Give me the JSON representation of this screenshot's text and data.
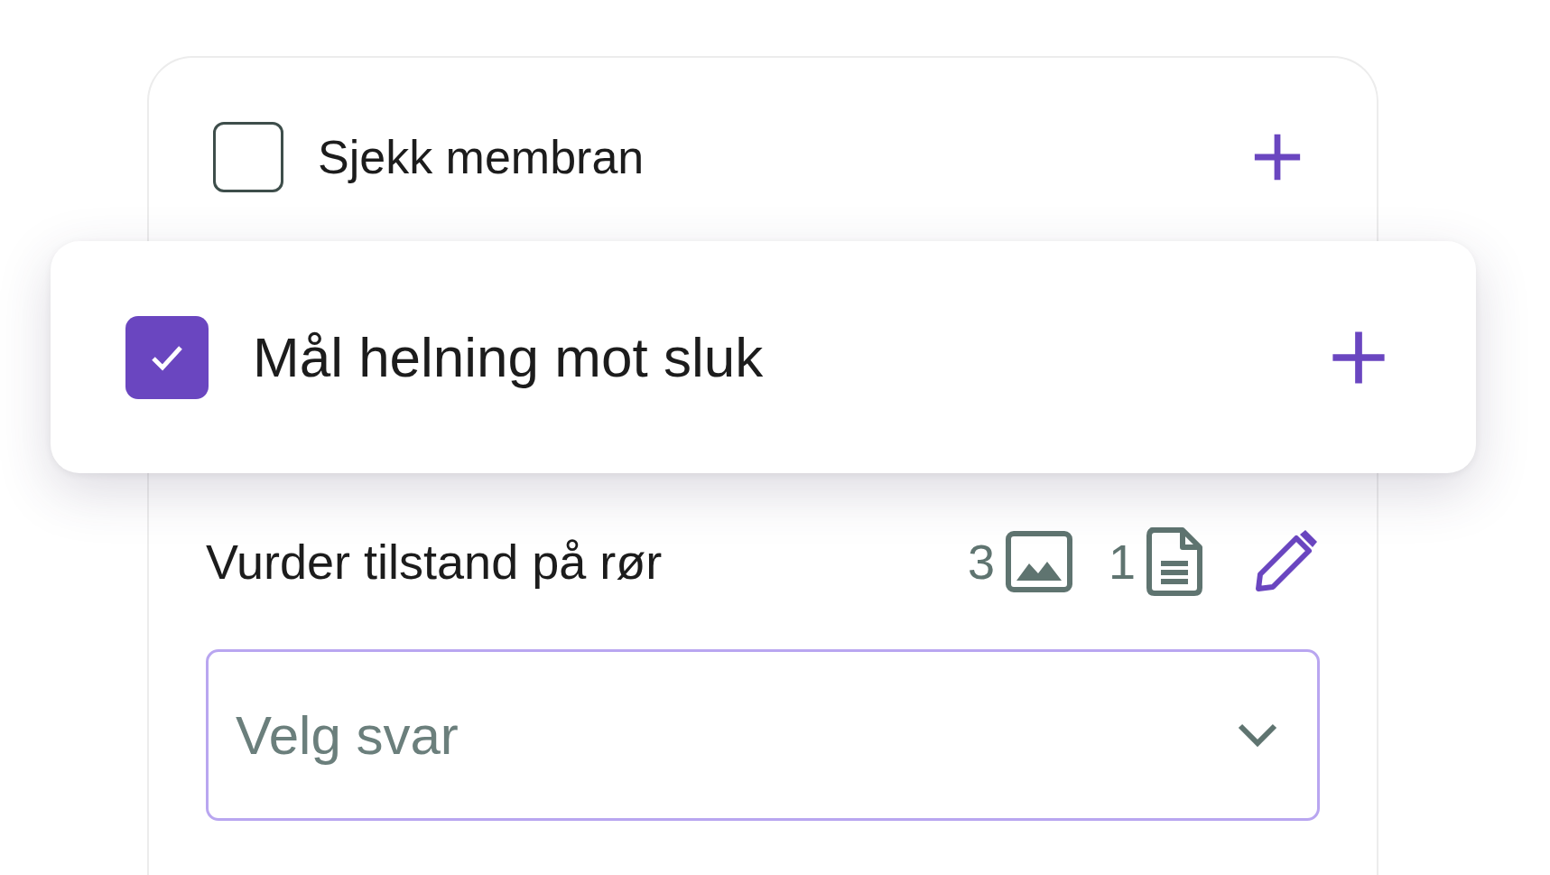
{
  "tasks": [
    {
      "label": "Sjekk membran",
      "checked": false,
      "kind": "row"
    },
    {
      "label": "Mål helning mot sluk",
      "checked": true,
      "kind": "lifted"
    }
  ],
  "question": {
    "label": "Vurder tilstand på rør",
    "image_count": "3",
    "document_count": "1"
  },
  "answer_select": {
    "placeholder": "Velg svar"
  }
}
